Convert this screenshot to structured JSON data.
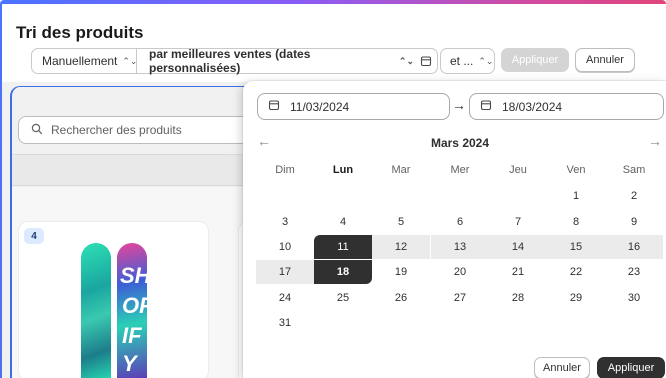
{
  "page": {
    "title": "Tri des produits"
  },
  "controls": {
    "sort_mode": "Manuellement",
    "sort_metric": "par meilleures ventes (dates personnalisées)",
    "conjunction": "et ...",
    "apply_label": "Appliquer",
    "cancel_label": "Annuler"
  },
  "search": {
    "placeholder": "Rechercher des produits"
  },
  "product": {
    "rank": "4"
  },
  "datepicker": {
    "start_date": "11/03/2024",
    "end_date": "18/03/2024",
    "month_label": "Mars 2024",
    "weekdays": [
      "Dim",
      "Lun",
      "Mar",
      "Mer",
      "Jeu",
      "Ven",
      "Sam"
    ],
    "weeks": [
      [
        "",
        "",
        "",
        "",
        "",
        "1",
        "2"
      ],
      [
        "3",
        "4",
        "5",
        "6",
        "7",
        "8",
        "9"
      ],
      [
        "10",
        "11",
        "12",
        "13",
        "14",
        "15",
        "16"
      ],
      [
        "17",
        "18",
        "19",
        "20",
        "21",
        "22",
        "23"
      ],
      [
        "24",
        "25",
        "26",
        "27",
        "28",
        "29",
        "30"
      ],
      [
        "31",
        "",
        "",
        "",
        "",
        "",
        ""
      ]
    ],
    "range_start_day": "11",
    "range_end_day": "18",
    "cancel_label": "Annuler",
    "apply_label": "Appliquer"
  },
  "colors": {
    "accent_blue": "#3a6fe8",
    "selected_bg": "#303030",
    "range_bg": "#ebebeb"
  },
  "icons": {
    "calendar": "calendar-icon",
    "search": "search-icon",
    "chevrons": "chevron-updown-icon",
    "arrow": "arrow-right-icon"
  }
}
